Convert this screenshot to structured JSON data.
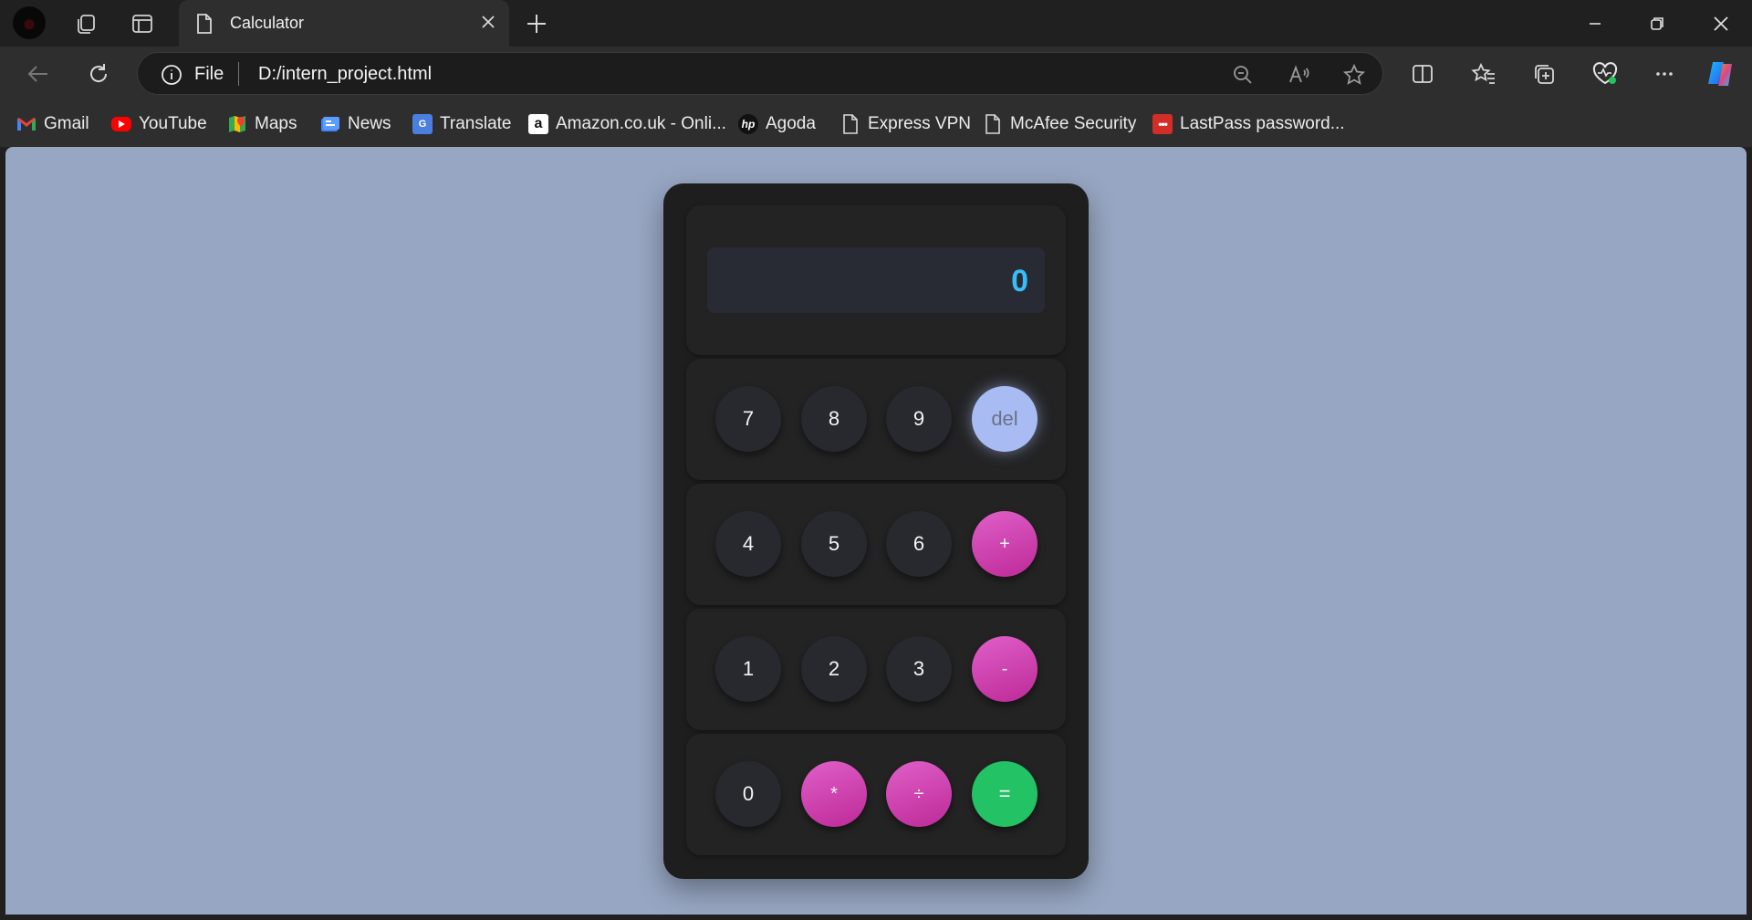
{
  "browser": {
    "tab": {
      "title": "Calculator"
    },
    "address_bar": {
      "scheme_label": "File",
      "url": "D:/intern_project.html"
    },
    "bookmarks": [
      {
        "label": "Gmail",
        "icon": "gmail-icon"
      },
      {
        "label": "YouTube",
        "icon": "youtube-icon"
      },
      {
        "label": "Maps",
        "icon": "maps-icon"
      },
      {
        "label": "News",
        "icon": "news-icon"
      },
      {
        "label": "Translate",
        "icon": "translate-icon"
      },
      {
        "label": "Amazon.co.uk - Onli...",
        "icon": "amazon-icon"
      },
      {
        "label": "Agoda",
        "icon": "hp-icon"
      },
      {
        "label": "Express VPN",
        "icon": "page-icon"
      },
      {
        "label": "McAfee Security",
        "icon": "page-icon"
      },
      {
        "label": "LastPass password...",
        "icon": "lastpass-icon"
      }
    ]
  },
  "calculator": {
    "display": "0",
    "rows": [
      [
        "7",
        "8",
        "9",
        "del"
      ],
      [
        "4",
        "5",
        "6",
        "+"
      ],
      [
        "1",
        "2",
        "3",
        "-"
      ],
      [
        "0",
        "*",
        "÷",
        "="
      ]
    ],
    "colors": {
      "display_text": "#38bdf8",
      "number_button": "#27292e",
      "operator_button": "#d145b4",
      "delete_button": "#a9bbf3",
      "equals_button": "#23c265",
      "page_background": "#97a6c2"
    }
  }
}
